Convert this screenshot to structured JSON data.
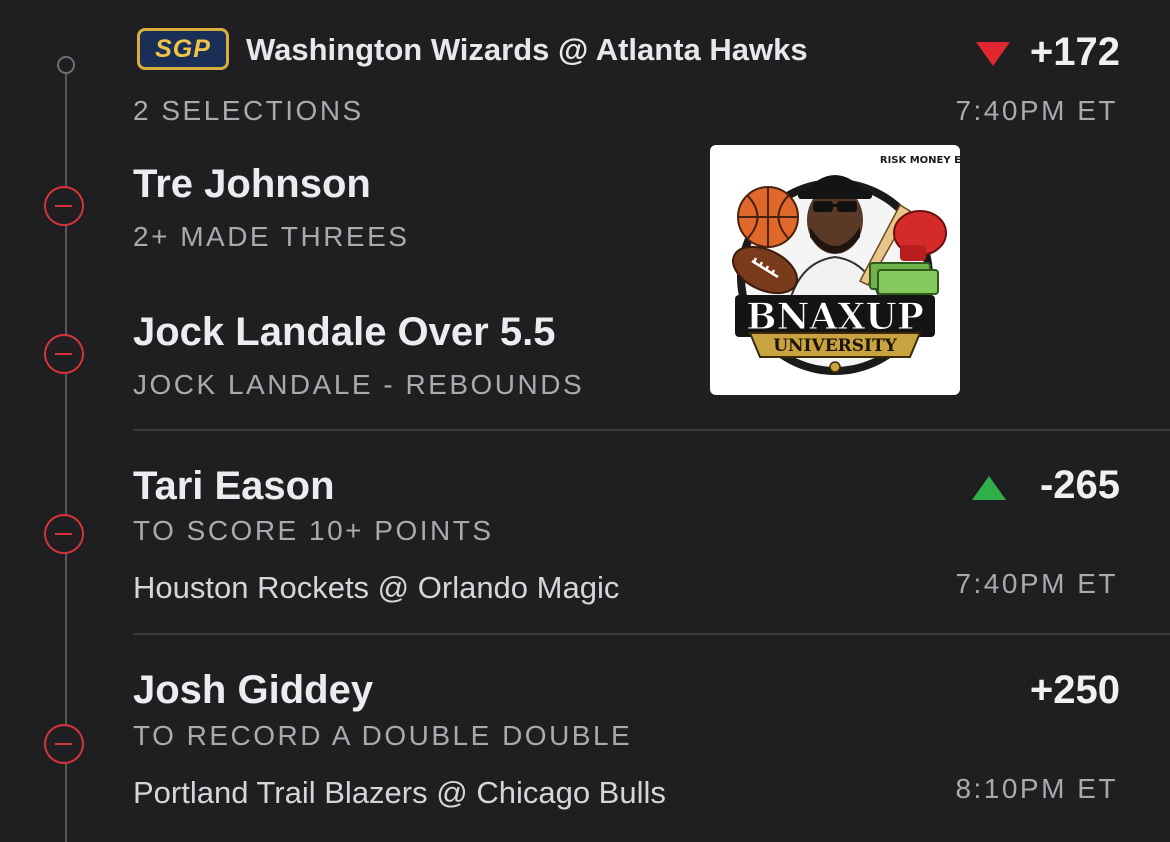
{
  "header": {
    "badge": "SGP",
    "game": "Washington Wizards @ Atlanta Hawks",
    "odds": "+172",
    "odds_trend": "down",
    "selections": "2 SELECTIONS",
    "time": "7:40PM ET"
  },
  "sgp_legs": [
    {
      "player": "Tre Johnson",
      "market": "2+ MADE THREES"
    },
    {
      "player": "Jock Landale Over 5.5",
      "market": "JOCK LANDALE - REBOUNDS"
    }
  ],
  "bets": [
    {
      "player": "Tari Eason",
      "market": "TO SCORE 10+ POINTS",
      "matchup": "Houston Rockets @ Orlando Magic",
      "time": "7:40PM ET",
      "odds": "-265",
      "odds_trend": "up"
    },
    {
      "player": "Josh Giddey",
      "market": "TO RECORD A DOUBLE DOUBLE",
      "matchup": "Portland Trail Blazers @ Chicago Bulls",
      "time": "8:10PM ET",
      "odds": "+250"
    }
  ],
  "logo": {
    "top_text": "RISK MONEY ENT",
    "main_text": "BNAXUP",
    "ribbon_text": "UNIVERSITY"
  },
  "colors": {
    "background": "#1f1f21",
    "remove_red": "#d6343a",
    "arrow_down": "#e0262e",
    "arrow_up": "#2fb04b",
    "badge_gold": "#d8ad3f",
    "badge_navy": "#1a2f55"
  }
}
